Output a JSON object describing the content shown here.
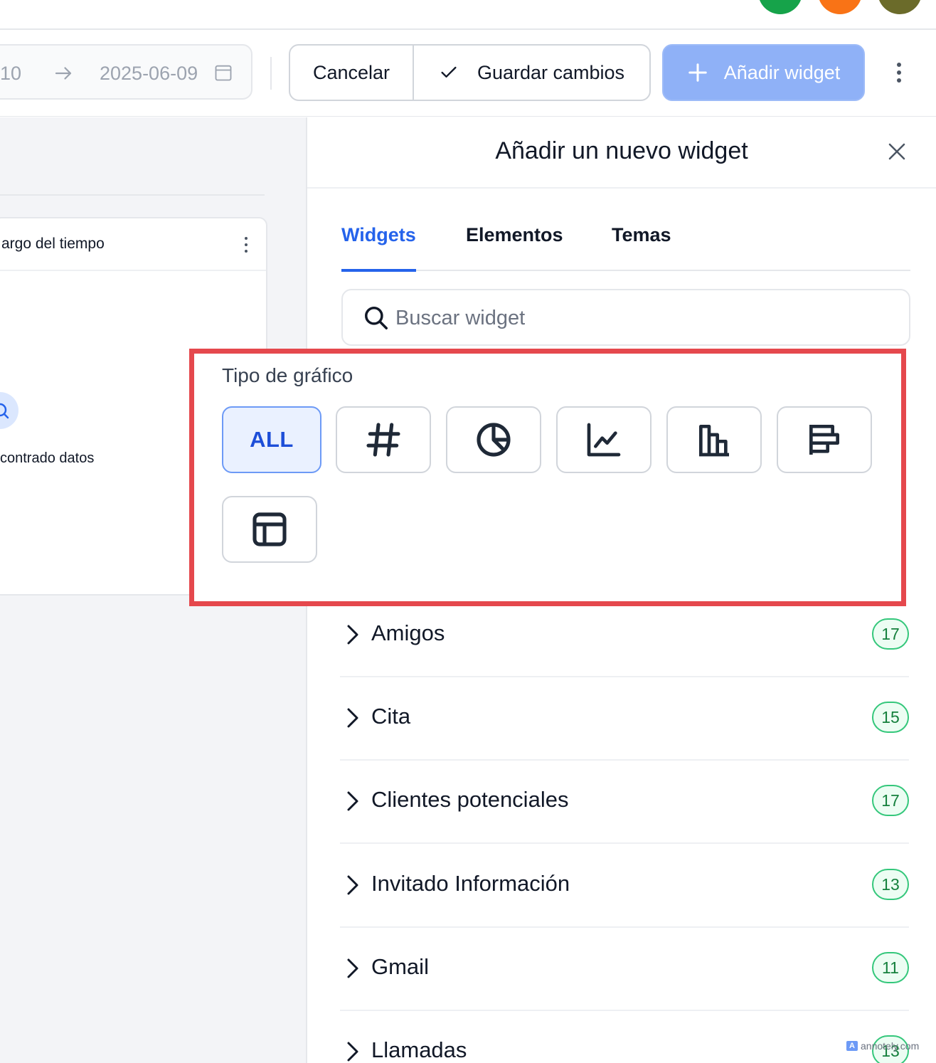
{
  "toolbar": {
    "date_start": "10",
    "date_end": "2025-06-09",
    "cancel_label": "Cancelar",
    "save_label": "Guardar cambios",
    "add_widget_label": "Añadir widget"
  },
  "avatars": [
    "#16a34a",
    "#f97316",
    "#6b6b2a"
  ],
  "left_card": {
    "title": "argo del tiempo",
    "empty_text": "contrado datos"
  },
  "panel": {
    "title": "Añadir un nuevo widget",
    "tabs": [
      {
        "label": "Widgets",
        "active": true
      },
      {
        "label": "Elementos",
        "active": false
      },
      {
        "label": "Temas",
        "active": false
      }
    ],
    "search_placeholder": "Buscar widget"
  },
  "chart_type": {
    "label": "Tipo de gráfico",
    "all_label": "ALL",
    "options": [
      "all",
      "hash-icon",
      "pie-chart-icon",
      "line-chart-icon",
      "bar-chart-icon",
      "horizontal-bar-icon",
      "table-icon"
    ]
  },
  "categories": [
    {
      "name": "Amigos",
      "count": "17"
    },
    {
      "name": "Cita",
      "count": "15"
    },
    {
      "name": "Clientes potenciales",
      "count": "17"
    },
    {
      "name": "Invitado Información",
      "count": "13"
    },
    {
      "name": "Gmail",
      "count": "11"
    },
    {
      "name": "Llamadas",
      "count": "13"
    }
  ],
  "watermark": "annotely.com",
  "colors": {
    "accent": "#2563eb",
    "add_button": "#8fb1f7",
    "highlight": "#e5484d",
    "badge_green": "#34c77b"
  }
}
